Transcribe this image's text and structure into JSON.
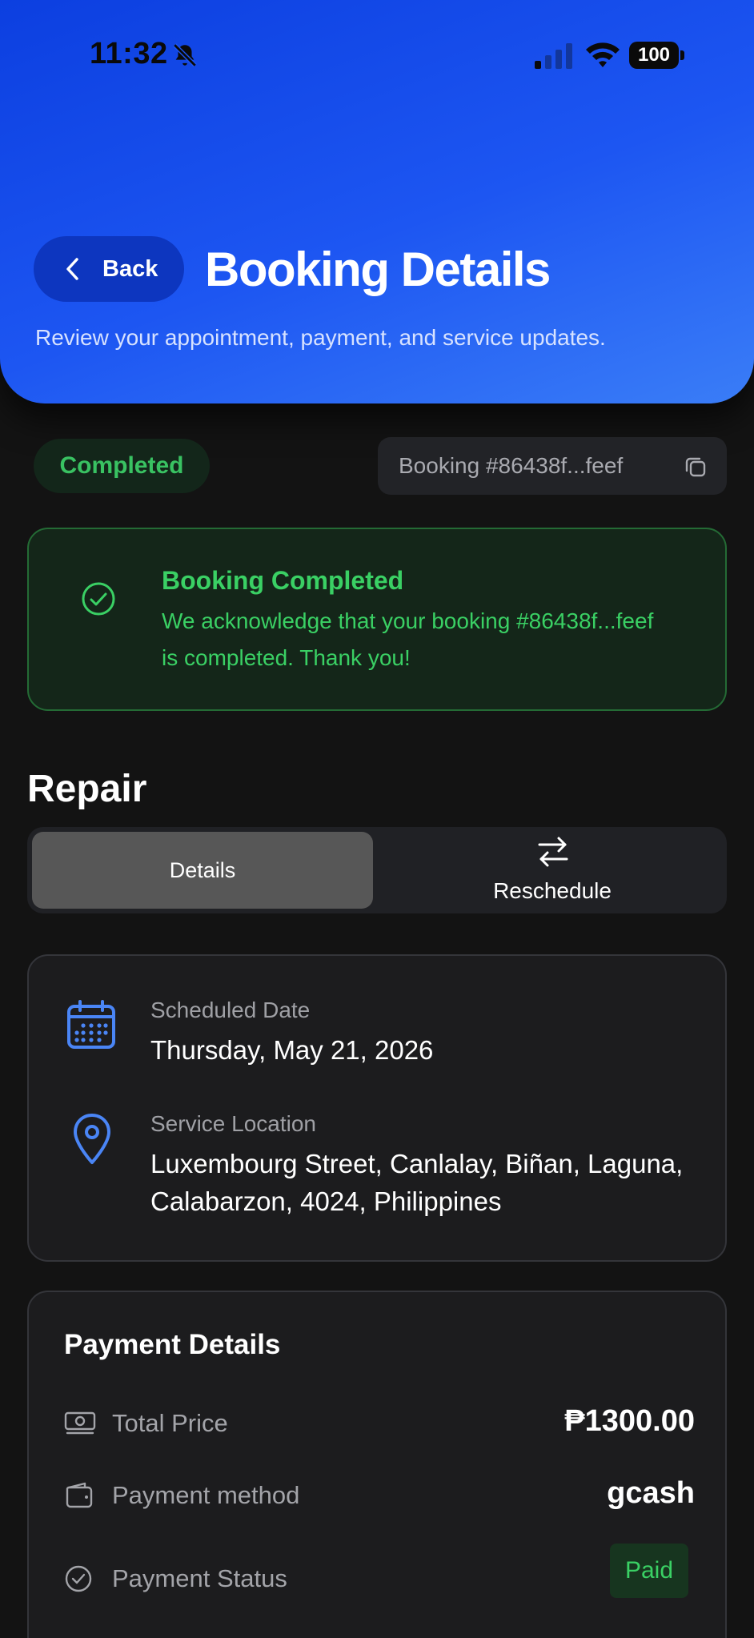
{
  "status_bar": {
    "time": "11:32",
    "battery": "100"
  },
  "header": {
    "back_label": "Back",
    "title": "Booking Details",
    "subtitle": "Review your appointment, payment, and service updates."
  },
  "booking": {
    "status": "Completed",
    "id_label": "Booking #86438f...feef"
  },
  "alert": {
    "title": "Booking Completed",
    "message": "We acknowledge that your booking #86438f...feef is completed. Thank you!"
  },
  "service": {
    "title": "Repair",
    "tabs": {
      "details": "Details",
      "reschedule": "Reschedule"
    }
  },
  "schedule": {
    "date_label": "Scheduled Date",
    "date_value": "Thursday, May 21, 2026",
    "location_label": "Service Location",
    "location_value": "Luxembourg Street, Canlalay, Biñan, Laguna, Calabarzon, 4024, Philippines"
  },
  "payment": {
    "title": "Payment Details",
    "total_label": "Total Price",
    "total_value": "₱1300.00",
    "method_label": "Payment method",
    "method_value": "gcash",
    "status_label": "Payment Status",
    "status_value": "Paid"
  },
  "colors": {
    "header_blue": "#1d56f2",
    "success_green": "#3ad064",
    "accent_icon_blue": "#4a85f5",
    "background": "#131313",
    "card": "#1c1c1e"
  },
  "icons": {
    "back": "chevron-left-icon",
    "copy": "copy-icon",
    "alert": "check-circle-icon",
    "reschedule": "swap-arrows-icon",
    "date": "calendar-icon",
    "location": "map-pin-icon",
    "total": "banknote-icon",
    "method": "wallet-icon",
    "status": "check-circle-icon"
  }
}
